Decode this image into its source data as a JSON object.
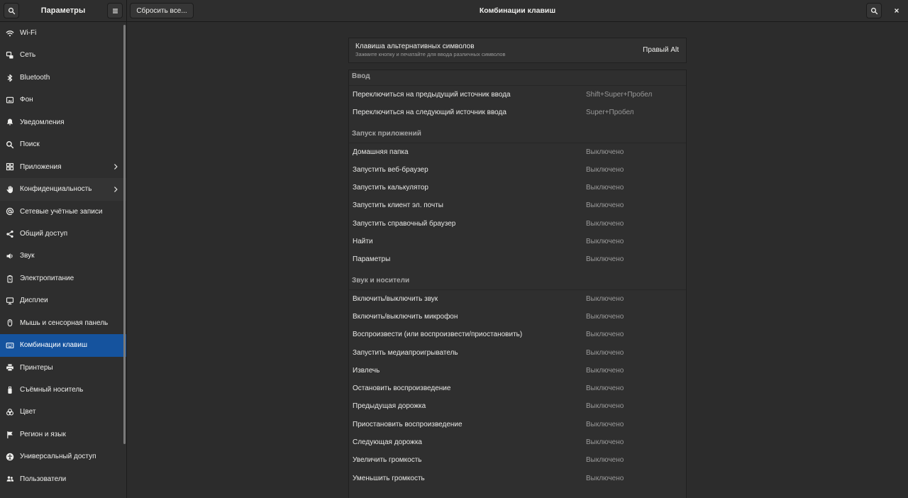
{
  "theme": {
    "accent": "#15539e"
  },
  "header": {
    "app_title": "Параметры",
    "reset_button": "Сбросить все...",
    "panel_title": "Комбинации клавиш",
    "left_search_icon": "search-icon",
    "menu_icon": "hamburger-menu-icon",
    "right_search_icon": "search-icon",
    "close_icon": "close-icon"
  },
  "sidebar": {
    "items": [
      {
        "label": "Wi-Fi",
        "icon": "wifi-icon"
      },
      {
        "label": "Сеть",
        "icon": "network-wired-icon"
      },
      {
        "label": "Bluetooth",
        "icon": "bluetooth-icon"
      },
      {
        "label": "Фон",
        "icon": "image-icon"
      },
      {
        "label": "Уведомления",
        "icon": "bell-icon"
      },
      {
        "label": "Поиск",
        "icon": "search-icon"
      },
      {
        "label": "Приложения",
        "icon": "apps-grid-icon",
        "chevron": true
      },
      {
        "label": "Конфиденциальность",
        "icon": "hand-icon",
        "chevron": true
      },
      {
        "label": "Сетевые учётные записи",
        "icon": "at-sign-icon"
      },
      {
        "label": "Общий доступ",
        "icon": "share-icon"
      },
      {
        "label": "Звук",
        "icon": "speaker-icon"
      },
      {
        "label": "Электропитание",
        "icon": "battery-icon"
      },
      {
        "label": "Дисплеи",
        "icon": "monitor-icon"
      },
      {
        "label": "Мышь и сенсорная панель",
        "icon": "mouse-icon"
      },
      {
        "label": "Комбинации клавиш",
        "icon": "keyboard-icon",
        "selected": true
      },
      {
        "label": "Принтеры",
        "icon": "printer-icon"
      },
      {
        "label": "Съёмный носитель",
        "icon": "usb-drive-icon"
      },
      {
        "label": "Цвет",
        "icon": "color-icon"
      },
      {
        "label": "Регион и язык",
        "icon": "flag-icon"
      },
      {
        "label": "Универсальный доступ",
        "icon": "accessibility-icon"
      },
      {
        "label": "Пользователи",
        "icon": "users-icon"
      }
    ]
  },
  "main": {
    "alt_key": {
      "title": "Клавиша альтернативных символов",
      "subtitle": "Зажмите кнопку и печатайте для ввода различных символов",
      "value": "Правый Alt"
    },
    "sections": [
      {
        "title": "Ввод",
        "rows": [
          {
            "label": "Переключиться на предыдущий источник ввода",
            "accel": "Shift+Super+Пробел"
          },
          {
            "label": "Переключиться на следующий источник ввода",
            "accel": "Super+Пробел"
          }
        ]
      },
      {
        "title": "Запуск приложений",
        "rows": [
          {
            "label": "Домашняя папка",
            "accel": "Выключено"
          },
          {
            "label": "Запустить веб-браузер",
            "accel": "Выключено"
          },
          {
            "label": "Запустить калькулятор",
            "accel": "Выключено"
          },
          {
            "label": "Запустить клиент эл. почты",
            "accel": "Выключено"
          },
          {
            "label": "Запустить справочный браузер",
            "accel": "Выключено"
          },
          {
            "label": "Найти",
            "accel": "Выключено"
          },
          {
            "label": "Параметры",
            "accel": "Выключено"
          }
        ]
      },
      {
        "title": "Звук и носители",
        "rows": [
          {
            "label": "Включить/выключить звук",
            "accel": "Выключено"
          },
          {
            "label": "Включить/выключить микрофон",
            "accel": "Выключено"
          },
          {
            "label": "Воспроизвести (или воспроизвести/приостановить)",
            "accel": "Выключено"
          },
          {
            "label": "Запустить медиапроигрыватель",
            "accel": "Выключено"
          },
          {
            "label": "Извлечь",
            "accel": "Выключено"
          },
          {
            "label": "Остановить воспроизведение",
            "accel": "Выключено"
          },
          {
            "label": "Предыдущая дорожка",
            "accel": "Выключено"
          },
          {
            "label": "Приостановить воспроизведение",
            "accel": "Выключено"
          },
          {
            "label": "Следующая дорожка",
            "accel": "Выключено"
          },
          {
            "label": "Увеличить громкость",
            "accel": "Выключено"
          },
          {
            "label": "Уменьшить громкость",
            "accel": "Выключено"
          }
        ]
      }
    ]
  }
}
